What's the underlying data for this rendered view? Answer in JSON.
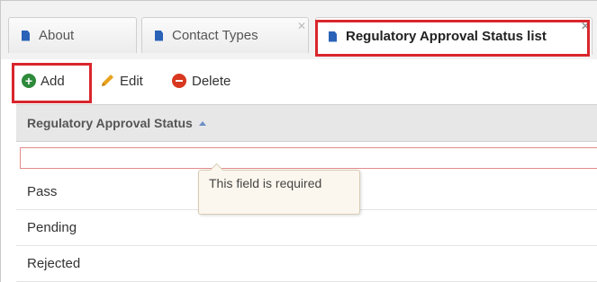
{
  "tabs": [
    {
      "label": "About",
      "closable": false,
      "active": false
    },
    {
      "label": "Contact Types",
      "closable": true,
      "active": false
    },
    {
      "label": "Regulatory Approval Status list",
      "closable": true,
      "active": true
    }
  ],
  "toolbar": {
    "add_label": "Add",
    "edit_label": "Edit",
    "delete_label": "Delete"
  },
  "grid": {
    "column_header": "Regulatory Approval Status",
    "sort": "ascending",
    "new_row_value": "",
    "rows": [
      "Pass",
      "Pending",
      "Rejected"
    ]
  },
  "validation": {
    "message": "This field is required"
  },
  "icons": {
    "tab": "document-icon",
    "add": "plus-circle-icon",
    "edit": "pencil-icon",
    "delete": "minus-circle-icon",
    "close": "close-icon",
    "sort": "sort-asc-icon"
  },
  "colors": {
    "highlight": "#d9262c",
    "tab_icon": "#2a62b8",
    "add": "#2d8a3b",
    "delete": "#d8381f"
  }
}
